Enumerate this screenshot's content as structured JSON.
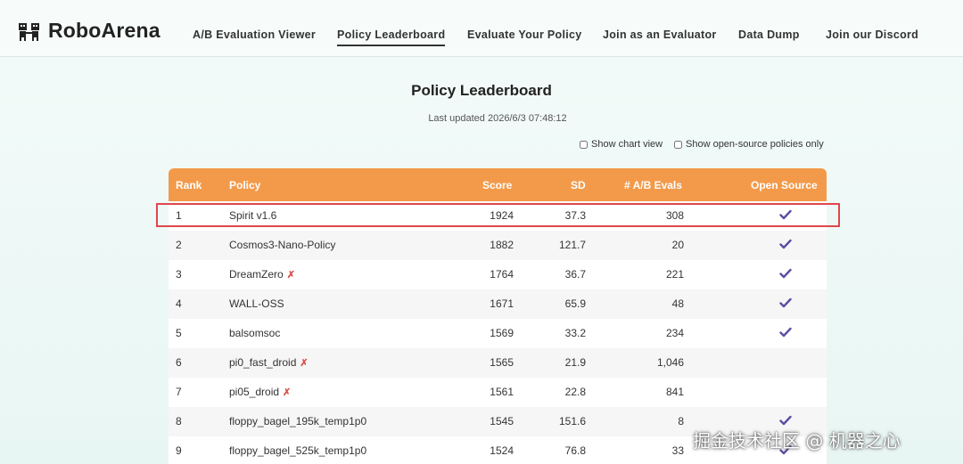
{
  "header": {
    "brand": "RoboArena",
    "nav": [
      {
        "label": "A/B Evaluation Viewer"
      },
      {
        "label": "Policy Leaderboard"
      },
      {
        "label": "Evaluate Your Policy"
      },
      {
        "label": "Join as an Evaluator"
      },
      {
        "label": "Data Dump"
      },
      {
        "label": "Join our Discord"
      }
    ],
    "active_nav": "Policy Leaderboard"
  },
  "page": {
    "title": "Policy Leaderboard",
    "updated": "Last updated 2026/6/3 07:48:12"
  },
  "options": {
    "chart_view": "Show chart view",
    "open_source_only": "Show open-source policies only"
  },
  "table": {
    "columns": [
      "Rank",
      "Policy",
      "Score",
      "SD",
      "# A/B Evals",
      "Open Source"
    ],
    "rows": [
      {
        "rank": "1",
        "policy": "Spirit v1.6",
        "score": "1924",
        "sd": "37.3",
        "evals": "308",
        "open_source": true,
        "x_mark": false
      },
      {
        "rank": "2",
        "policy": "Cosmos3-Nano-Policy",
        "score": "1882",
        "sd": "121.7",
        "evals": "20",
        "open_source": true,
        "x_mark": false
      },
      {
        "rank": "3",
        "policy": "DreamZero",
        "score": "1764",
        "sd": "36.7",
        "evals": "221",
        "open_source": true,
        "x_mark": true
      },
      {
        "rank": "4",
        "policy": "WALL-OSS",
        "score": "1671",
        "sd": "65.9",
        "evals": "48",
        "open_source": true,
        "x_mark": false
      },
      {
        "rank": "5",
        "policy": "balsomsoc",
        "score": "1569",
        "sd": "33.2",
        "evals": "234",
        "open_source": true,
        "x_mark": false
      },
      {
        "rank": "6",
        "policy": "pi0_fast_droid",
        "score": "1565",
        "sd": "21.9",
        "evals": "1,046",
        "open_source": false,
        "x_mark": true
      },
      {
        "rank": "7",
        "policy": "pi05_droid",
        "score": "1561",
        "sd": "22.8",
        "evals": "841",
        "open_source": false,
        "x_mark": true
      },
      {
        "rank": "8",
        "policy": "floppy_bagel_195k_temp1p0",
        "score": "1545",
        "sd": "151.6",
        "evals": "8",
        "open_source": true,
        "x_mark": false
      },
      {
        "rank": "9",
        "policy": "floppy_bagel_525k_temp1p0",
        "score": "1524",
        "sd": "76.8",
        "evals": "33",
        "open_source": true,
        "x_mark": false
      }
    ]
  },
  "icons": {
    "check": "check-icon",
    "x_mark": "x-mark-icon"
  },
  "colors": {
    "header_bg": "#f39a4a",
    "check": "#5b4fa3",
    "highlight": "#e0474c"
  },
  "watermark": "掘金技术社区 @ 机器之心"
}
